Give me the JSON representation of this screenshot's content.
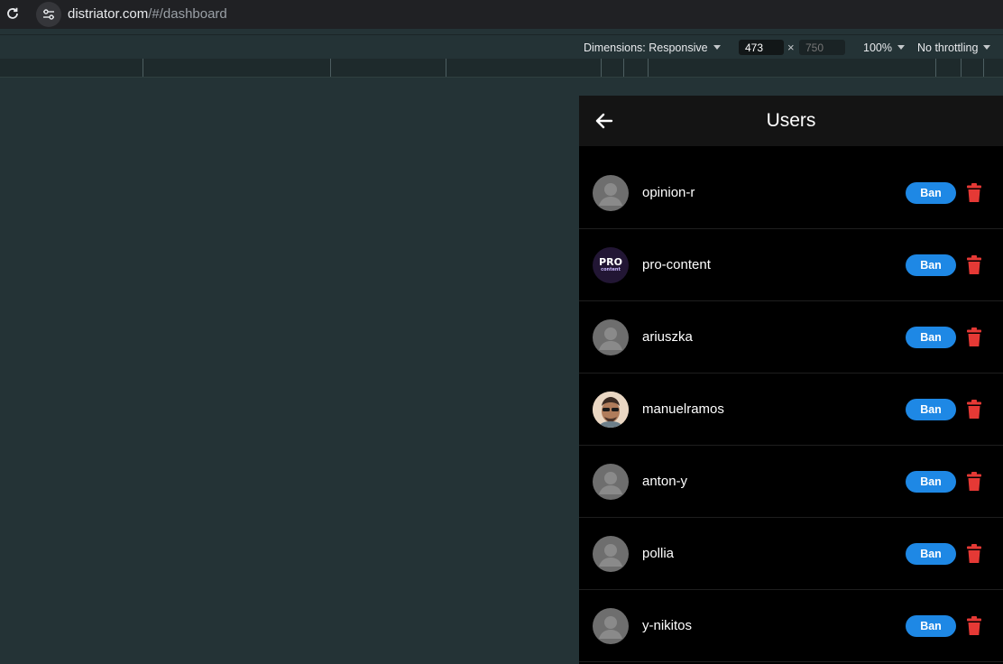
{
  "browser": {
    "url_host": "distriator.com",
    "url_path": "/#/dashboard"
  },
  "devtools": {
    "dimensions_label": "Dimensions: Responsive",
    "width": "473",
    "times": "×",
    "height_placeholder": "750",
    "zoom": "100%",
    "throttling": "No throttling"
  },
  "app": {
    "title": "Users",
    "ban_label": "Ban",
    "colors": {
      "ban_button": "#1e88e5",
      "delete_icon": "#e53935",
      "header_bg": "#141414",
      "list_bg": "#000000"
    },
    "icons": {
      "back": "arrow-left-icon",
      "delete": "trash-icon",
      "default_avatar": "person-icon"
    },
    "users": [
      {
        "name": "opinion-r",
        "avatar": "default"
      },
      {
        "name": "pro-content",
        "avatar": "pro",
        "avatar_text_top": "PRO",
        "avatar_text_bottom": "content"
      },
      {
        "name": "ariuszka",
        "avatar": "default"
      },
      {
        "name": "manuelramos",
        "avatar": "photo"
      },
      {
        "name": "anton-y",
        "avatar": "default"
      },
      {
        "name": "pollia",
        "avatar": "default"
      },
      {
        "name": "y-nikitos",
        "avatar": "default"
      }
    ]
  }
}
